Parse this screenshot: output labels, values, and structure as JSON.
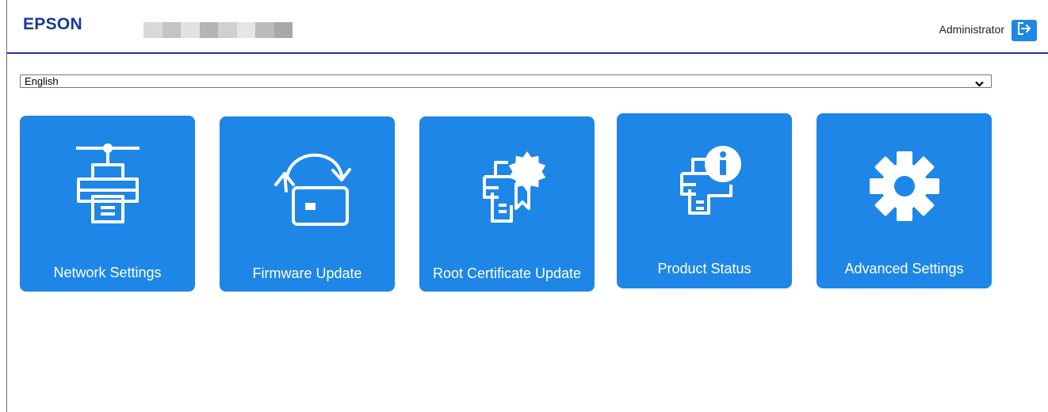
{
  "header": {
    "logo_text": "EPSON",
    "user_label": "Administrator",
    "logout_icon": "logout-icon",
    "product_name_blurred": true
  },
  "language_select": {
    "selected": "English",
    "icon": "chevron-down-icon"
  },
  "tiles": [
    {
      "label": "Network Settings",
      "icon": "network-printer-icon"
    },
    {
      "label": "Firmware Update",
      "icon": "firmware-update-icon"
    },
    {
      "label": "Root Certificate Update",
      "icon": "certificate-printer-icon"
    },
    {
      "label": "Product Status",
      "icon": "printer-info-icon"
    },
    {
      "label": "Advanced Settings",
      "icon": "gear-icon"
    }
  ],
  "colors": {
    "brand": "#1a3a94",
    "tile": "#1e86e6",
    "tile_text": "#ffffff"
  }
}
